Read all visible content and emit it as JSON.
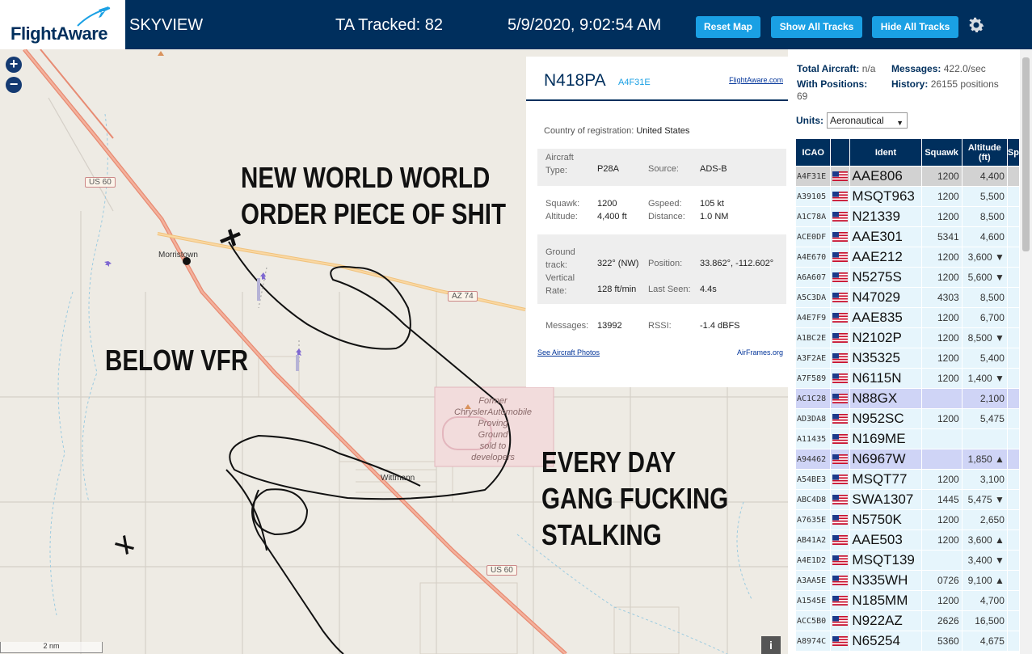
{
  "header": {
    "logo_text": "FlightAware",
    "app_title": "SKYVIEW",
    "tracked_label": "TA Tracked: 82",
    "datetime": "5/9/2020, 9:02:54 AM",
    "buttons": {
      "reset": "Reset Map",
      "show_all": "Show All Tracks",
      "hide_all": "Hide All Tracks"
    }
  },
  "map": {
    "zoom_in": "+",
    "zoom_out": "−",
    "captions": [
      "NEW WORLD WORLD\nORDER PIECE OF SHIT",
      "BELOW VFR",
      "EVERY DAY\nGANG FUCKING\nSTALKING"
    ],
    "labels": {
      "town1": "Morristown",
      "town2": "Wittmann",
      "landmark": "Former\nChryslerAutomobile\nProving\nGround\nsold to\ndevelopers",
      "road_us60_a": "US 60",
      "road_az74": "AZ 74",
      "road_us60_b": "US 60"
    },
    "scale": "2 nm",
    "info": "i"
  },
  "selected": {
    "ident": "N418PA",
    "icao": "A4F31E",
    "fa_link": "FlightAware.com",
    "country_label": "Country of registration:",
    "country": "United States",
    "aircraft_type_label": "Aircraft Type:",
    "aircraft_type": "P28A",
    "source_label": "Source:",
    "source": "ADS-B",
    "squawk_label": "Squawk:",
    "squawk": "1200",
    "gspeed_label": "Gspeed:",
    "gspeed": "105 kt",
    "altitude_label": "Altitude:",
    "altitude": "4,400 ft",
    "distance_label": "Distance:",
    "distance": "1.0 NM",
    "track_label": "Ground track:",
    "track": "322° (NW)",
    "position_label": "Position:",
    "position": "33.862°, -112.602°",
    "vrate_label": "Vertical Rate:",
    "vrate": "128 ft/min",
    "lastseen_label": "Last Seen:",
    "lastseen": "4.4s",
    "messages_label": "Messages:",
    "messages": "13992",
    "rssi_label": "RSSI:",
    "rssi": "-1.4 dBFS",
    "photos_link": "See Aircraft Photos",
    "airframes_link": "AirFrames.org"
  },
  "stats": {
    "total_label": "Total Aircraft:",
    "total": "n/a",
    "messages_label": "Messages:",
    "messages": "422.0/sec",
    "positions_label": "With Positions:",
    "positions": "69",
    "history_label": "History:",
    "history": "26155 positions",
    "units_label": "Units:",
    "units_value": "Aeronautical"
  },
  "table": {
    "headers": {
      "icao": "ICAO",
      "ident": "Ident",
      "squawk": "Squawk",
      "altitude": "Altitude (ft)",
      "speed": "Sp"
    },
    "rows": [
      {
        "icao": "A4F31E",
        "ident": "AAE806",
        "squawk": "1200",
        "alt": "4,400",
        "trend": "",
        "state": "sel"
      },
      {
        "icao": "A39105",
        "ident": "MSQT963",
        "squawk": "1200",
        "alt": "5,500",
        "trend": "",
        "state": ""
      },
      {
        "icao": "A1C78A",
        "ident": "N21339",
        "squawk": "1200",
        "alt": "8,500",
        "trend": "",
        "state": ""
      },
      {
        "icao": "ACE0DF",
        "ident": "AAE301",
        "squawk": "5341",
        "alt": "4,600",
        "trend": "",
        "state": ""
      },
      {
        "icao": "A4E670",
        "ident": "AAE212",
        "squawk": "1200",
        "alt": "3,600",
        "trend": "▼",
        "state": ""
      },
      {
        "icao": "A6A607",
        "ident": "N5275S",
        "squawk": "1200",
        "alt": "5,600",
        "trend": "▼",
        "state": ""
      },
      {
        "icao": "A5C3DA",
        "ident": "N47029",
        "squawk": "4303",
        "alt": "8,500",
        "trend": "",
        "state": ""
      },
      {
        "icao": "A4E7F9",
        "ident": "AAE835",
        "squawk": "1200",
        "alt": "6,700",
        "trend": "",
        "state": ""
      },
      {
        "icao": "A1BC2E",
        "ident": "N2102P",
        "squawk": "1200",
        "alt": "8,500",
        "trend": "▼",
        "state": ""
      },
      {
        "icao": "A3F2AE",
        "ident": "N35325",
        "squawk": "1200",
        "alt": "5,400",
        "trend": "",
        "state": ""
      },
      {
        "icao": "A7F589",
        "ident": "N6115N",
        "squawk": "1200",
        "alt": "1,400",
        "trend": "▼",
        "state": ""
      },
      {
        "icao": "AC1C28",
        "ident": "N88GX",
        "squawk": "",
        "alt": "2,100",
        "trend": "",
        "state": "hl"
      },
      {
        "icao": "AD3DA8",
        "ident": "N952SC",
        "squawk": "1200",
        "alt": "5,475",
        "trend": "",
        "state": ""
      },
      {
        "icao": "A11435",
        "ident": "N169ME",
        "squawk": "",
        "alt": "",
        "trend": "",
        "state": ""
      },
      {
        "icao": "A94462",
        "ident": "N6967W",
        "squawk": "",
        "alt": "1,850",
        "trend": "▲",
        "state": "hl"
      },
      {
        "icao": "A54BE3",
        "ident": "MSQT77",
        "squawk": "1200",
        "alt": "3,100",
        "trend": "",
        "state": ""
      },
      {
        "icao": "ABC4D8",
        "ident": "SWA1307",
        "squawk": "1445",
        "alt": "5,475",
        "trend": "▼",
        "state": ""
      },
      {
        "icao": "A7635E",
        "ident": "N5750K",
        "squawk": "1200",
        "alt": "2,650",
        "trend": "",
        "state": ""
      },
      {
        "icao": "AB41A2",
        "ident": "AAE503",
        "squawk": "1200",
        "alt": "3,600",
        "trend": "▲",
        "state": ""
      },
      {
        "icao": "A4E1D2",
        "ident": "MSQT139",
        "squawk": "",
        "alt": "3,400",
        "trend": "▼",
        "state": ""
      },
      {
        "icao": "A3AA5E",
        "ident": "N335WH",
        "squawk": "0726",
        "alt": "9,100",
        "trend": "▲",
        "state": ""
      },
      {
        "icao": "A1545E",
        "ident": "N185MM",
        "squawk": "1200",
        "alt": "4,700",
        "trend": "",
        "state": ""
      },
      {
        "icao": "ACC5B0",
        "ident": "N922AZ",
        "squawk": "2626",
        "alt": "16,500",
        "trend": "",
        "state": ""
      },
      {
        "icao": "A8974C",
        "ident": "N65254",
        "squawk": "5360",
        "alt": "4,675",
        "trend": "",
        "state": ""
      }
    ]
  },
  "colors": {
    "header_bg": "#002f5d",
    "button_bg": "#1aa0e4",
    "row_bg": "#e6f5fc",
    "row_selected": "#d2d2d2",
    "row_highlight": "#cfd4f6"
  },
  "icons": {
    "gear": "gear-icon",
    "flag": "us-flag-icon",
    "plane": "airplane-icon",
    "logo": "flightaware-plane-icon"
  }
}
